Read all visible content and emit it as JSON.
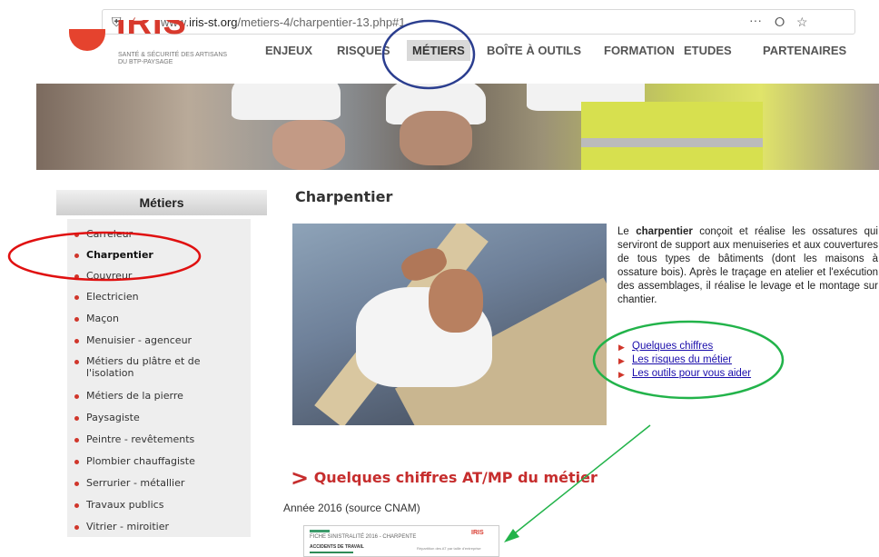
{
  "browser": {
    "url_prefix": "www.",
    "url_domain": "iris-st.org",
    "url_path": "/metiers-4/charpentier-13.php#1",
    "menu_icon": "···"
  },
  "logo": {
    "word": "IRIS",
    "tagline_1": "SANTÉ & SÉCURITÉ DES ARTISANS",
    "tagline_2": "DU BTP-PAYSAGE"
  },
  "nav": {
    "items": [
      "ENJEUX",
      "RISQUES",
      "MÉTIERS",
      "BOÎTE À OUTILS",
      "FORMATION",
      "ETUDES",
      "PARTENAIRES"
    ],
    "active": "MÉTIERS"
  },
  "sidebar": {
    "title": "Métiers",
    "items": [
      "Carreleur",
      "Charpentier",
      "Couvreur",
      "Electricien",
      "Maçon",
      "Menuisier - agenceur",
      "Métiers du plâtre et de l'isolation",
      "Métiers de la pierre",
      "Paysagiste",
      "Peintre - revêtements",
      "Plombier chauffagiste",
      "Serrurier - métallier",
      "Travaux publics",
      "Vitrier - miroitier"
    ],
    "selected": "Charpentier"
  },
  "main": {
    "title": "Charpentier",
    "desc_lead": "Le ",
    "desc_bold": "charpentier",
    "desc_rest": " conçoit et réalise les ossatures qui serviront de support aux menuiseries et aux couvertures de tous types de bâtiments (dont les maisons à ossature bois). Après le traçage en atelier et l'exécution des assemblages, il réalise le levage et le montage sur chantier.",
    "links": [
      "Quelques chiffres",
      "Les risques du métier",
      "Les outils pour vous aider"
    ],
    "section_title": "Quelques chiffres AT/MP du métier",
    "year_text": "Année 2016 (source CNAM)",
    "sheet": {
      "header": "FICHE SINISTRALITÉ 2016 - CHARPENTE",
      "subheader": "ACCIDENTS DE TRAVAIL",
      "logo": "IRIS",
      "note": "Répartition des AT par taille d'entreprise"
    }
  },
  "colors": {
    "accent_red": "#d0362b",
    "link_blue": "#1a0dab",
    "annotation_blue": "#2b3e8f",
    "annotation_red": "#e01010",
    "annotation_green": "#22b34a"
  }
}
